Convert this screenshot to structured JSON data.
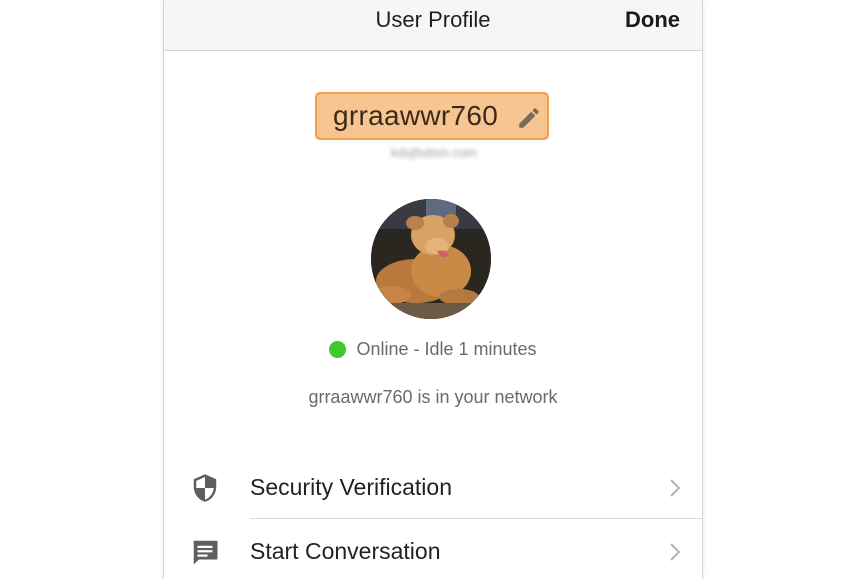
{
  "navbar": {
    "title": "User Profile",
    "done_label": "Done"
  },
  "profile": {
    "username": "grraawwr760",
    "edit_icon": "pencil-icon",
    "email_blurred": "kdsjfsdsm.com",
    "status_text": "Online - Idle 1 minutes",
    "status_color": "#3dcb2c",
    "network_text": "grraawwr760 is in your network"
  },
  "list": {
    "items": [
      {
        "label": "Security Verification",
        "icon": "shield-icon"
      },
      {
        "label": "Start Conversation",
        "icon": "chat-icon"
      }
    ]
  },
  "colors": {
    "highlight_fill": "#f6c591",
    "highlight_border": "#f0a04a"
  }
}
